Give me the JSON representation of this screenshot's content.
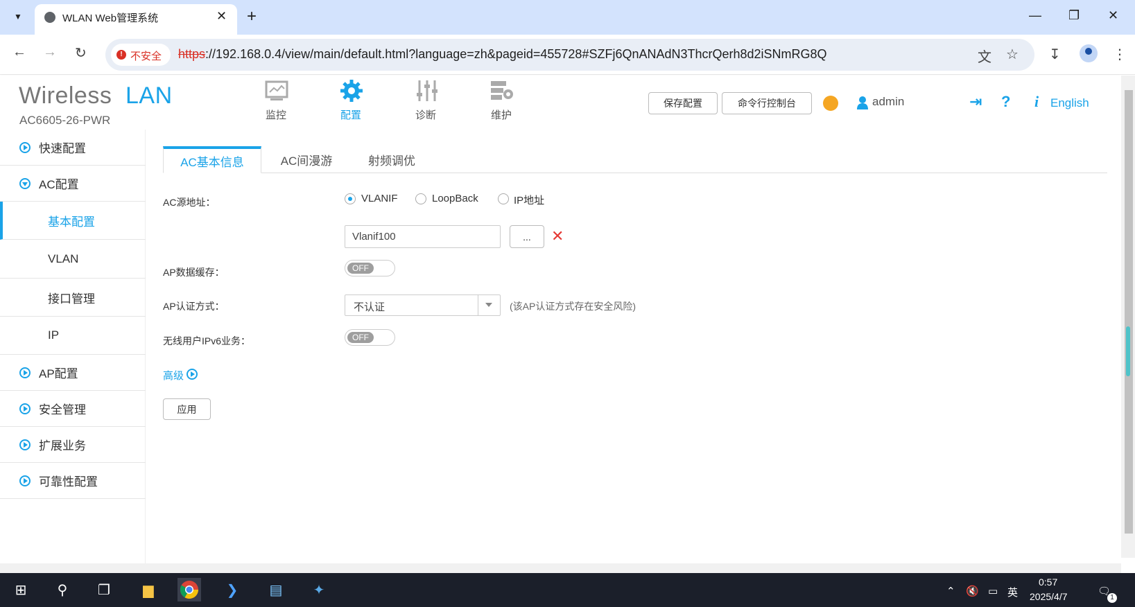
{
  "browser": {
    "tab_title": "WLAN Web管理系统",
    "security_label": "不安全",
    "url_scheme": "https",
    "url_rest": "://192.168.0.4/view/main/default.html?language=zh&pageid=455728#SZFj6QnANAdN3ThcrQerh8d2iSNmRG8Q"
  },
  "header": {
    "logo_wireless": "Wireless",
    "logo_lan": "LAN",
    "model": "AC6605-26-PWR",
    "nav": [
      {
        "label": "监控",
        "icon": "monitor-icon"
      },
      {
        "label": "配置",
        "icon": "gear-icon"
      },
      {
        "label": "诊断",
        "icon": "sliders-icon"
      },
      {
        "label": "维护",
        "icon": "maintenance-icon"
      }
    ],
    "save_config": "保存配置",
    "cli_console": "命令行控制台",
    "user": "admin",
    "language": "English"
  },
  "sidebar": {
    "items": [
      {
        "label": "快速配置"
      },
      {
        "label": "AC配置"
      },
      {
        "label": "AP配置"
      },
      {
        "label": "安全管理"
      },
      {
        "label": "扩展业务"
      },
      {
        "label": "可靠性配置"
      }
    ],
    "sub_items": [
      {
        "label": "基本配置",
        "active": true
      },
      {
        "label": "VLAN"
      },
      {
        "label": "接口管理"
      },
      {
        "label": "IP"
      }
    ]
  },
  "content": {
    "tabs": [
      {
        "label": "AC基本信息",
        "active": true
      },
      {
        "label": "AC间漫游"
      },
      {
        "label": "射频调优"
      }
    ],
    "ac_source_label": "AC源地址：",
    "radio_vlanif": "VLANIF",
    "radio_loopback": "LoopBack",
    "radio_ip": "IP地址",
    "vlanif_value": "Vlanif100",
    "browse_label": "...",
    "ap_cache_label": "AP数据缓存：",
    "ap_cache_state": "OFF",
    "ap_auth_label": "AP认证方式：",
    "ap_auth_value": "不认证",
    "ap_auth_note": "(该AP认证方式存在安全风险)",
    "ipv6_label": "无线用户IPv6业务：",
    "ipv6_state": "OFF",
    "advanced": "高级",
    "apply": "应用"
  },
  "taskbar": {
    "time": "0:57",
    "date": "2025/4/7",
    "ime": "英",
    "notif_count": "1"
  },
  "colors": {
    "accent": "#1aa3e8",
    "danger": "#e53935",
    "taskbar": "#1b1f2a"
  }
}
